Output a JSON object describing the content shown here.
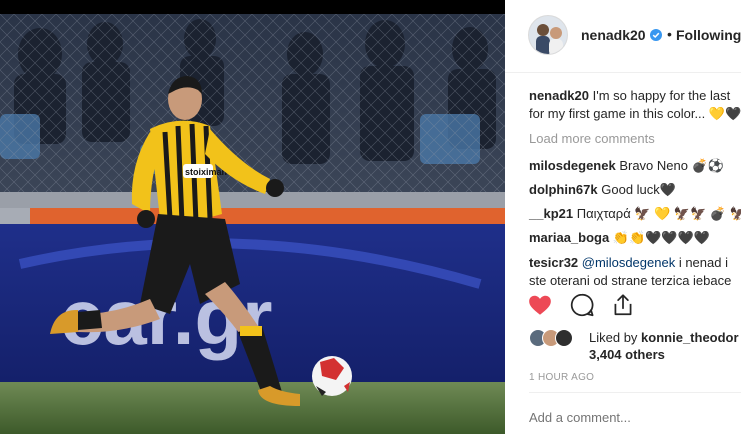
{
  "post_image": {
    "banner_text": "car.gr",
    "shirt_sponsor": "stoiximan"
  },
  "header": {
    "username": "nenadk20",
    "separator": "•",
    "follow_status": "Following"
  },
  "caption": {
    "username": "nenadk20",
    "text": "I'm so happy for the last",
    "line2": "for my first game in this color... 💛🖤"
  },
  "load_more": "Load more comments",
  "comments": [
    {
      "username": "milosdegenek",
      "text": "Bravo Neno 💣⚽"
    },
    {
      "username": "dolphin67k",
      "text": "Good luck🖤"
    },
    {
      "username": "__kp21",
      "text": "Παιχταρά 🦅 💛 🦅🦅 💣 🦅"
    },
    {
      "username": "mariaa_boga",
      "text": "👏👏🖤🖤🖤🖤"
    },
    {
      "username": "tesicr32",
      "mention": "@milosdegenek",
      "text": " i nenad i",
      "line2": "ste oterani od strane terzica iebace"
    }
  ],
  "likes": {
    "prefix": "Liked by",
    "user": "konnie_theodor",
    "count_text": "3,404 others"
  },
  "timestamp": "1 HOUR AGO",
  "add_comment_placeholder": "Add a comment...",
  "colors": {
    "like_red": "#ed4956",
    "verified_blue": "#3897f0",
    "muted": "#999999",
    "jersey_yellow": "#f2c21a"
  }
}
